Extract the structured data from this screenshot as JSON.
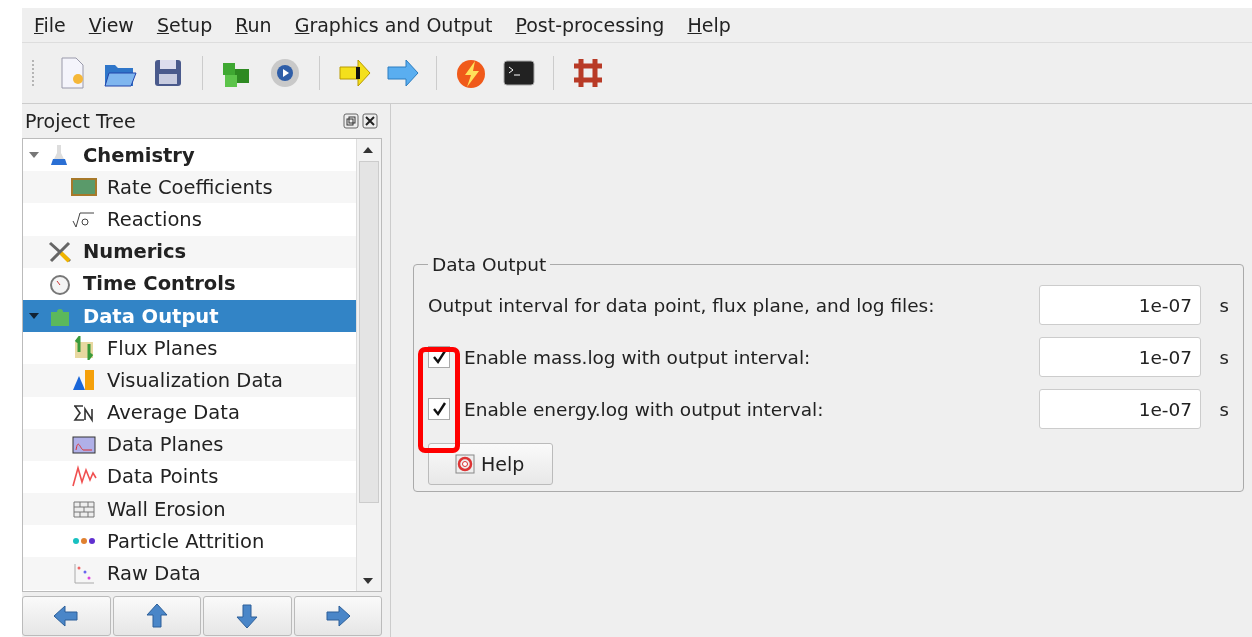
{
  "menu": [
    {
      "accel": "F",
      "rest": "ile"
    },
    {
      "accel": "V",
      "rest": "iew"
    },
    {
      "accel": "S",
      "rest": "etup"
    },
    {
      "accel": "R",
      "rest": "un"
    },
    {
      "accel": "G",
      "rest": "raphics and Output"
    },
    {
      "accel": "P",
      "rest": "ost-processing"
    },
    {
      "accel": "H",
      "rest": "elp"
    }
  ],
  "project_tree": {
    "title": "Project Tree",
    "items": [
      {
        "label": "Chemistry",
        "selected": false,
        "expanded": true,
        "children": [
          {
            "label": "Rate Coefficients",
            "selected": false
          },
          {
            "label": "Reactions",
            "selected": false
          }
        ]
      },
      {
        "label": "Numerics",
        "selected": false
      },
      {
        "label": "Time Controls",
        "selected": false
      },
      {
        "label": "Data Output",
        "selected": true,
        "expanded": true,
        "children": [
          {
            "label": "Flux Planes",
            "selected": false
          },
          {
            "label": "Visualization Data",
            "selected": false
          },
          {
            "label": "Average Data",
            "selected": false
          },
          {
            "label": "Data Planes",
            "selected": false
          },
          {
            "label": "Data Points",
            "selected": false
          },
          {
            "label": "Wall Erosion",
            "selected": false
          },
          {
            "label": "Particle Attrition",
            "selected": false
          },
          {
            "label": "Raw Data",
            "selected": false
          }
        ]
      }
    ]
  },
  "data_output": {
    "title": "Data Output",
    "rows": [
      {
        "kind": "interval",
        "label": "Output interval for data point, flux plane, and log files:",
        "value": "1e-07",
        "unit": "s"
      },
      {
        "kind": "checkbox",
        "checked": true,
        "label": "Enable mass.log with output interval:",
        "value": "1e-07",
        "unit": "s"
      },
      {
        "kind": "checkbox",
        "checked": true,
        "label": "Enable energy.log with output interval:",
        "value": "1e-07",
        "unit": "s"
      }
    ],
    "help_button": "Help"
  }
}
